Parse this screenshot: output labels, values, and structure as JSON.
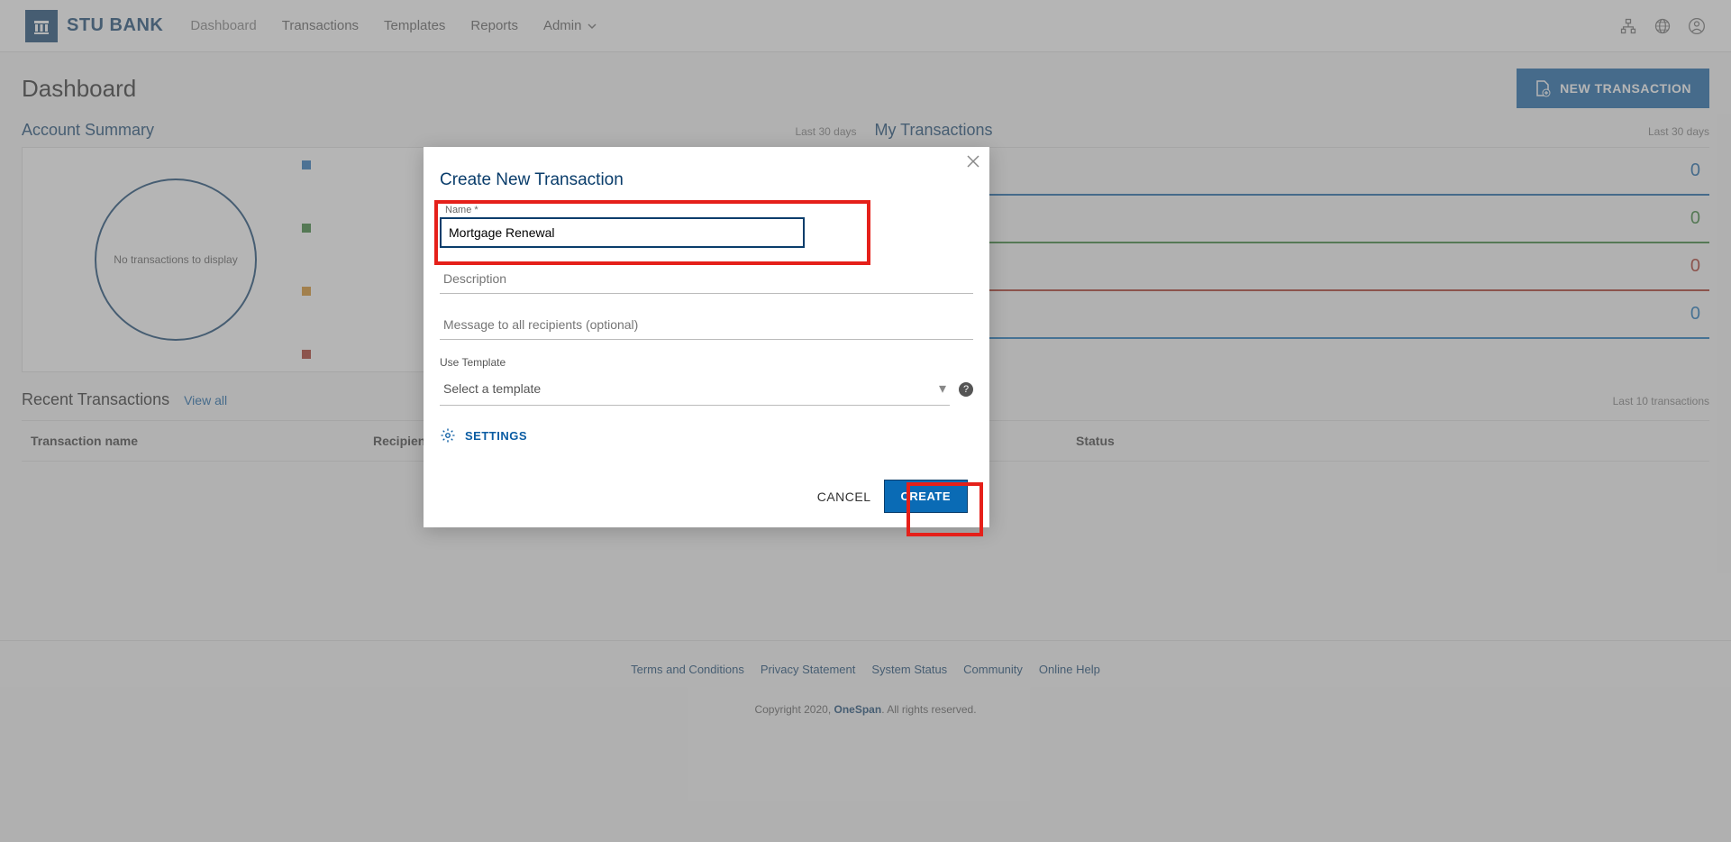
{
  "brand": "STU BANK",
  "nav": {
    "items": [
      "Dashboard",
      "Transactions",
      "Templates",
      "Reports",
      "Admin"
    ]
  },
  "page": {
    "title": "Dashboard",
    "new_transaction_btn": "NEW TRANSACTION"
  },
  "account_summary": {
    "title": "Account Summary",
    "period": "Last 30 days",
    "empty": "No transactions to display"
  },
  "my_transactions": {
    "title": "My Transactions",
    "period": "Last 30 days",
    "stats": [
      {
        "value": "0",
        "color": "#0a5ca3"
      },
      {
        "value": "0",
        "color": "#2a7a2a"
      },
      {
        "value": "0",
        "color": "#a5281a"
      },
      {
        "value": "0",
        "color": "#0a6bb5"
      }
    ]
  },
  "recent": {
    "title": "Recent Transactions",
    "view_all": "View all",
    "period": "Last 10 transactions",
    "columns": {
      "name": "Transaction name",
      "recipients": "Recipients",
      "status": "Status"
    }
  },
  "footer": {
    "links": [
      "Terms and Conditions",
      "Privacy Statement",
      "System Status",
      "Community",
      "Online Help"
    ],
    "copyright_pre": "Copyright 2020, ",
    "copyright_brand": "OneSpan",
    "copyright_post": ". All rights reserved."
  },
  "modal": {
    "title": "Create New Transaction",
    "name_label": "Name *",
    "name_value": "Mortgage Renewal",
    "description_placeholder": "Description",
    "message_placeholder": "Message to all recipients (optional)",
    "template_label": "Use Template",
    "template_placeholder": "Select a template",
    "settings": "SETTINGS",
    "cancel": "CANCEL",
    "create": "CREATE"
  }
}
